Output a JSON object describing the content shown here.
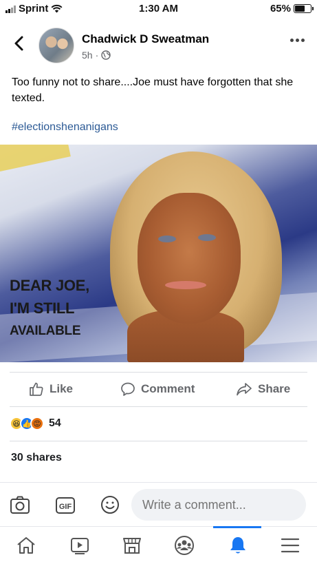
{
  "status_bar": {
    "carrier": "Sprint",
    "time": "1:30 AM",
    "battery": "65%",
    "battery_level": 0.65
  },
  "post": {
    "author": "Chadwick D Sweatman",
    "time_ago": "5h",
    "meta_separator": "·",
    "text": "Too funny not to share....Joe must have forgotten that she texted.",
    "hashtag": "#electionshenanigans",
    "image_text": [
      "DEAR JOE,",
      "I'M STILL",
      "AVAILABLE"
    ]
  },
  "actions": {
    "like": "Like",
    "comment": "Comment",
    "share": "Share"
  },
  "reactions": {
    "types": [
      "haha",
      "like",
      "angry"
    ],
    "count": "54"
  },
  "shares": "30 shares",
  "comment_bar": {
    "placeholder": "Write a comment...",
    "gif_label": "GIF"
  },
  "bottom_nav": {
    "items": [
      "home-icon",
      "watch-icon",
      "marketplace-icon",
      "groups-icon",
      "notifications-icon",
      "menu-icon"
    ],
    "active": "notifications-icon",
    "accent_color": "#1877f2"
  }
}
